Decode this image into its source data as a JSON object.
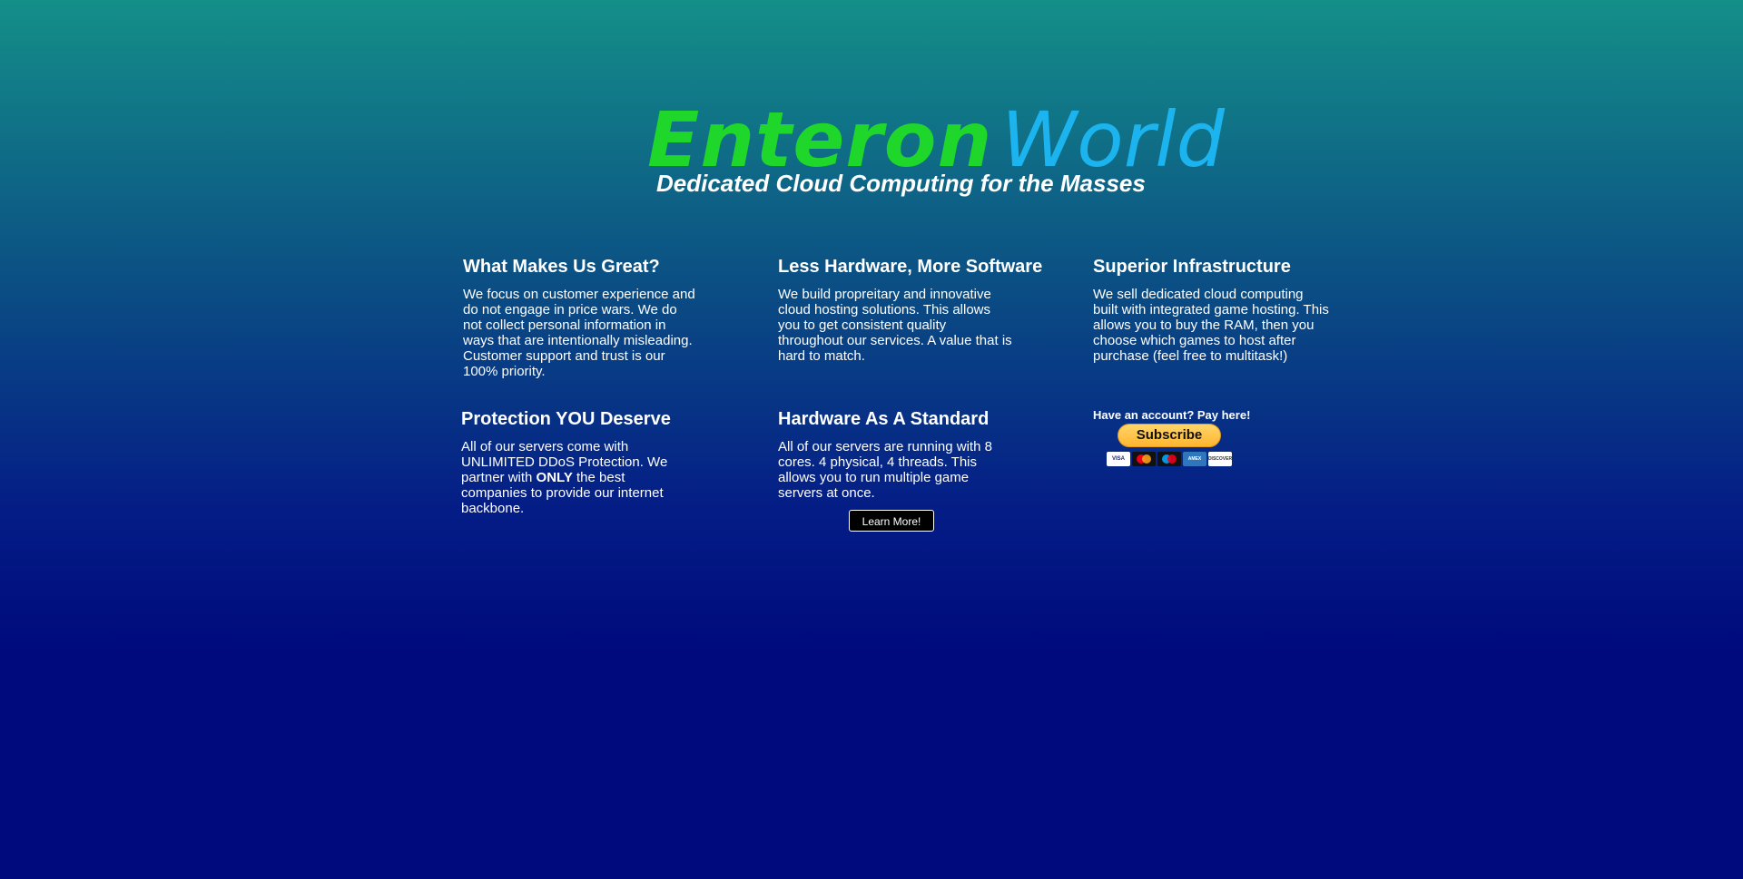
{
  "logo": {
    "word1": "Enteron",
    "word2": "World",
    "tagline": "Dedicated Cloud Computing for the Masses",
    "colors": {
      "word1": "#1fd62a",
      "word2": "#1cb4ef"
    }
  },
  "sections": [
    {
      "title": "What Makes Us Great?",
      "body": "We focus on customer experience and do not engage in price wars. We do not collect personal information in ways that are intentionally misleading. Customer support and trust is our 100% priority."
    },
    {
      "title": "Less Hardware, More Software",
      "body": "We build propreitary and innovative cloud hosting solutions. This allows you to get consistent quality throughout our services. A value that is hard to match."
    },
    {
      "title": "Superior Infrastructure",
      "body": "We sell dedicated cloud computing built with integrated game hosting. This allows you to buy the RAM, then you choose which games to host after purchase (feel free to multitask!)"
    },
    {
      "title": "Protection YOU Deserve",
      "body_before": "All of our servers come with UNLIMITED DDoS Protection. We partner with ",
      "body_bold": "ONLY",
      "body_after": " the best companies to provide our internet backbone."
    },
    {
      "title": "Hardware As A Standard",
      "body": "All of our servers are running with 8 cores. 4 physical, 4 threads. This allows you to run multiple game servers at once.",
      "button": "Learn More!"
    }
  ],
  "payment": {
    "label": "Have an account? Pay here!",
    "button": "Subscribe",
    "cards": [
      {
        "name": "visa-card-icon",
        "label": "VISA"
      },
      {
        "name": "mastercard-icon",
        "label": ""
      },
      {
        "name": "maestro-icon",
        "label": ""
      },
      {
        "name": "amex-icon",
        "label": "AMEX"
      },
      {
        "name": "discover-icon",
        "label": "DISCOVER"
      }
    ]
  },
  "colors": {
    "bg_top": "#148f89",
    "bg_bottom": "#000a7c",
    "subscribe_button": "#ffc439"
  }
}
